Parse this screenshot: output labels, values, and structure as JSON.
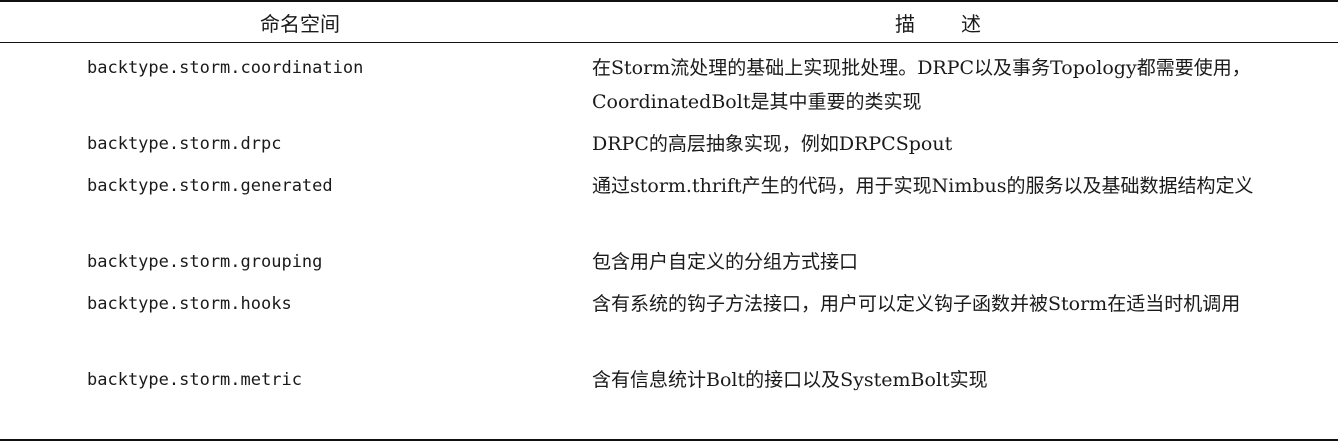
{
  "table": {
    "headers": {
      "namespace": "命名空间",
      "description": "描　　述"
    },
    "rows": [
      {
        "namespace": "backtype.storm.coordination",
        "description": "在Storm流处理的基础上实现批处理。DRPC以及事务Topology都需要使用，CoordinatedBolt是其中重要的类实现"
      },
      {
        "namespace": "backtype.storm.drpc",
        "description": "DRPC的高层抽象实现，例如DRPCSpout"
      },
      {
        "namespace": "backtype.storm.generated",
        "description": "通过storm.thrift产生的代码，用于实现Nimbus的服务以及基础数据结构定义"
      },
      {
        "namespace": "backtype.storm.grouping",
        "description": "包含用户自定义的分组方式接口"
      },
      {
        "namespace": "backtype.storm.hooks",
        "description": "含有系统的钩子方法接口，用户可以定义钩子函数并被Storm在适当时机调用"
      },
      {
        "namespace": "backtype.storm.metric",
        "description": "含有信息统计Bolt的接口以及SystemBolt实现"
      }
    ]
  }
}
